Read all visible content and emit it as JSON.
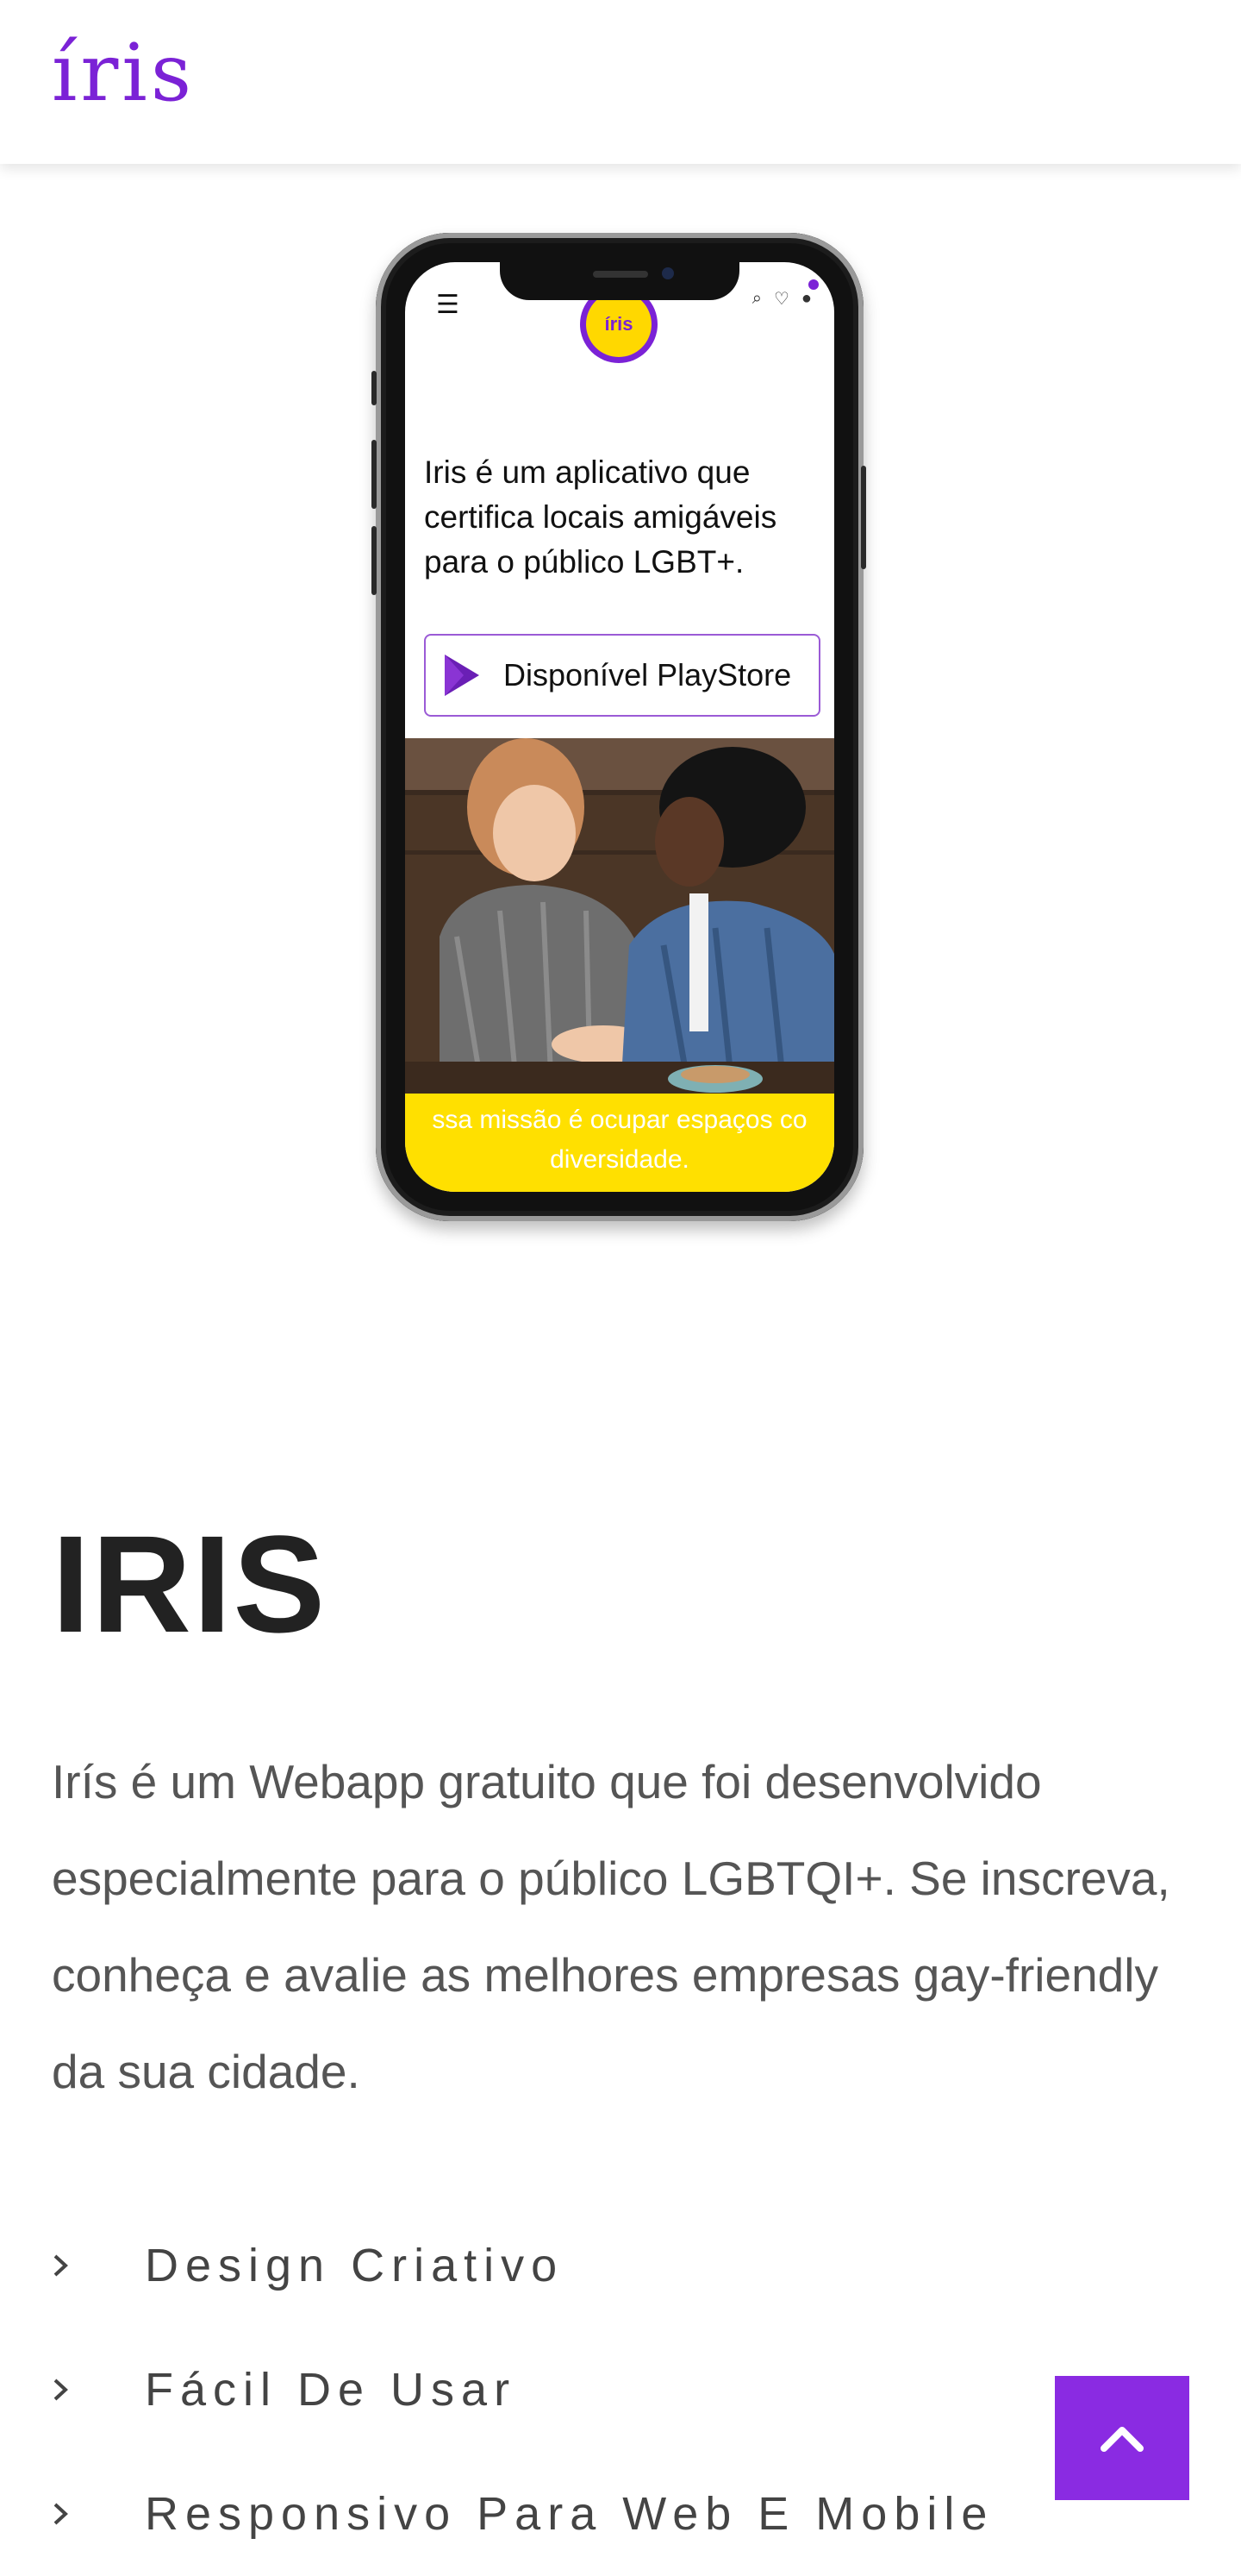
{
  "header": {
    "logo": "íris"
  },
  "mockup": {
    "app_logo": "íris",
    "app_text": "Iris é um aplicativo que certifica locais amigáveis para o público LGBT+.",
    "cta_label": "Disponível PlayStore",
    "band_text_1": "ssa missão é ocupar espaços co",
    "band_text_2": "diversidade."
  },
  "main": {
    "title": "IRIS",
    "description": "Irís é um Webapp gratuito que foi desenvolvido especialmente para o público LGBTQI+. Se inscreva, conheça e avalie as melhores empresas gay-friendly da sua cidade.",
    "features": [
      {
        "label": "Design Criativo"
      },
      {
        "label": "Fácil De Usar"
      },
      {
        "label": "Responsivo Para Web E Mobile"
      }
    ]
  },
  "colors": {
    "accent": "#8a2be2",
    "logo": "#7b22d6",
    "yellow": "#ffe000"
  }
}
